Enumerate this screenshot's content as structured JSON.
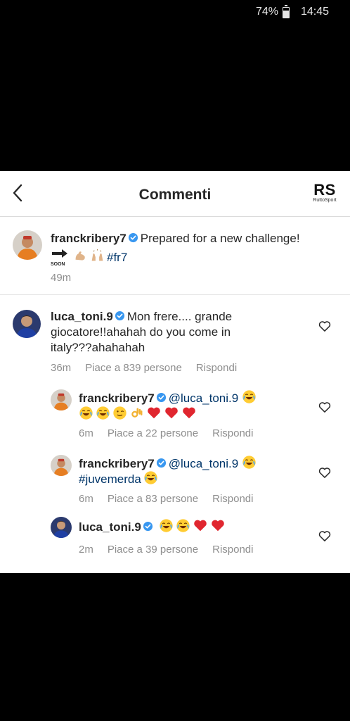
{
  "status_bar": {
    "battery": "74%",
    "time": "14:45"
  },
  "header": {
    "title": "Commenti",
    "logo_mark": "RS",
    "logo_sub": "RuttoSport"
  },
  "caption": {
    "username": "franckribery7",
    "text": "Prepared for a new challenge!",
    "soon_label": "SOON",
    "hashtag": "#fr7",
    "time": "49m"
  },
  "comments": [
    {
      "username": "luca_toni.9",
      "line1": "Mon frere.... grande",
      "line2": "giocatore!!ahahah do you come in",
      "line3": "italy???ahahahah",
      "time": "36m",
      "likes": "Piace a 839 persone",
      "reply": "Rispondi"
    },
    {
      "username": "franckribery7",
      "mention": "@luca_toni.9",
      "time": "6m",
      "likes": "Piace a 22 persone",
      "reply": "Rispondi"
    },
    {
      "username": "franckribery7",
      "mention": "@luca_toni.9",
      "hashtag": "#juvemerda",
      "time": "6m",
      "likes": "Piace a 83 persone",
      "reply": "Rispondi"
    },
    {
      "username": "luca_toni.9",
      "time": "2m",
      "likes": "Piace a 39 persone",
      "reply": "Rispondi"
    }
  ],
  "icons": {
    "back": "chevron-left-icon",
    "verified": "verified-badge-icon",
    "like": "heart-outline-icon",
    "emoji_laugh": "face-with-tears-of-joy",
    "emoji_wink": "winking-face",
    "emoji_ok": "ok-hand",
    "emoji_heart": "red-heart",
    "emoji_muscle": "flexed-biceps",
    "emoji_raise": "raising-hands"
  },
  "colors": {
    "verified": "#3897f0",
    "hashtag": "#003569",
    "meta": "#8e8e8e",
    "heart": "#ed4956"
  }
}
